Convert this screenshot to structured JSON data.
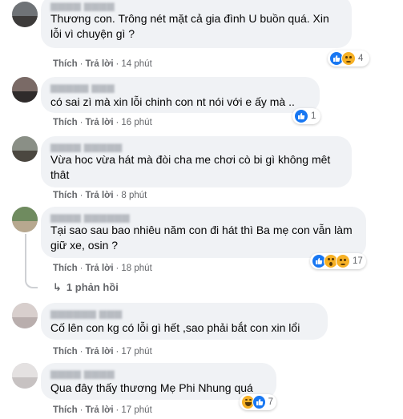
{
  "labels": {
    "like": "Thích",
    "reply": "Trả lời",
    "dot": "·"
  },
  "comments": [
    {
      "text": "Thương con. Trông nét mặt cả gia đình U buồn quá. Xin lỗi vì chuyện gì ?",
      "time": "14 phút",
      "reaction_count": "4",
      "reactions": [
        "like-icon",
        "sad-icon"
      ]
    },
    {
      "text": "có sai zì mà xin lỗi chinh con nt nói với e ấy mà ..",
      "time": "16 phút",
      "reaction_count": "1",
      "reactions": [
        "like-icon"
      ]
    },
    {
      "text": "Vừa hoc vừa hát mà đòi cha me chơi cò bi gì không mêt thât",
      "time": "8 phút",
      "reaction_count": "",
      "reactions": []
    },
    {
      "text": "Tại sao sau bao nhiêu năm con đi hát thì Ba mẹ con vẫn làm giữ xe, osin ?",
      "time": "18 phút",
      "reaction_count": "17",
      "reactions": [
        "like-icon",
        "wow-icon",
        "sad-icon"
      ],
      "replies": "1 phản hồi"
    },
    {
      "text": "Cố lên con kg có lỗi gì hết ,sao phải bắt con xin lổi",
      "time": "17 phút",
      "reaction_count": "",
      "reactions": []
    },
    {
      "text": "Qua đây thấy thương Mẹ Phi Nhung quá",
      "time": "17 phút",
      "reaction_count": "7",
      "reactions": [
        "haha-icon",
        "like-icon"
      ]
    }
  ],
  "colors": {
    "like_blue": "#1877f2",
    "emoji_yellow": "#f7b125",
    "bubble": "#f0f2f5",
    "meta_gray": "#65676b"
  }
}
